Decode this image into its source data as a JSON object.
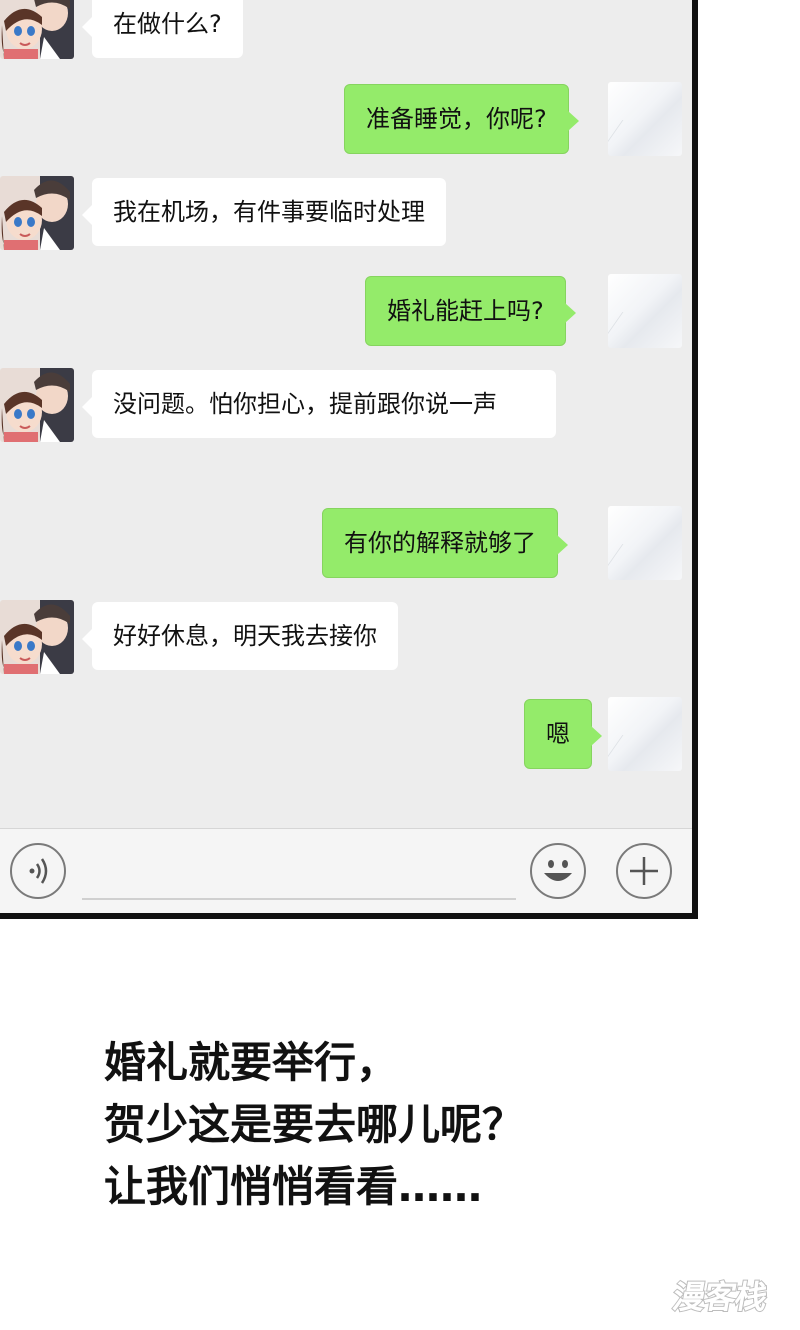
{
  "messages": [
    {
      "side": "left",
      "text": "在做什么?"
    },
    {
      "side": "right",
      "text": "准备睡觉，你呢?"
    },
    {
      "side": "left",
      "text": "我在机场，有件事要临时处理"
    },
    {
      "side": "right",
      "text": "婚礼能赶上吗?"
    },
    {
      "side": "left",
      "text": "没问题。怕你担心，提前跟你说一声"
    },
    {
      "side": "right",
      "text": "有你的解释就够了"
    },
    {
      "side": "left",
      "text": "好好休息，明天我去接你"
    },
    {
      "side": "right",
      "text": "嗯"
    }
  ],
  "input_bar": {
    "voice_icon": "voice-icon",
    "emoji_icon": "emoji-icon",
    "plus_icon": "plus-icon",
    "value": ""
  },
  "caption": {
    "line1": "婚礼就要举行，",
    "line2": "贺少这是要去哪儿呢？",
    "line3": "让我们悄悄看看……"
  },
  "watermark": {
    "text": "漫客栈"
  },
  "colors": {
    "chat_background": "#ededed",
    "sent_bubble": "#94eb6a",
    "received_bubble": "#ffffff"
  }
}
